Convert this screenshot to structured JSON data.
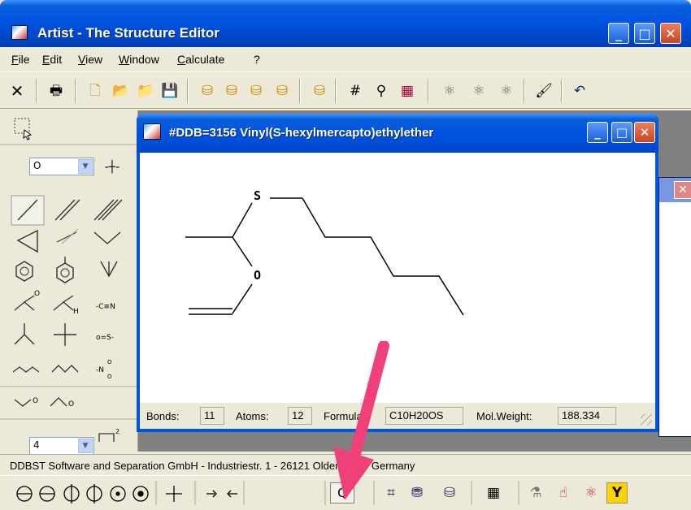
{
  "main_window": {
    "title": "Artist - The Structure Editor",
    "controls": {
      "minimize": "_",
      "maximize": "□",
      "close": "✕"
    }
  },
  "menu": [
    {
      "label": "File"
    },
    {
      "label": "Edit"
    },
    {
      "label": "View"
    },
    {
      "label": "Window"
    },
    {
      "label": "Calculate"
    },
    {
      "label": "?"
    }
  ],
  "toolbar": [
    {
      "icon": "delete-icon",
      "glyph": "✕"
    },
    {
      "icon": "print-icon",
      "glyph": "🖶"
    },
    {
      "icon": "new-icon",
      "glyph": "🗋"
    },
    {
      "icon": "open-icon",
      "glyph": "📂"
    },
    {
      "icon": "open-db-icon",
      "glyph": "📁"
    },
    {
      "icon": "save-icon",
      "glyph": "💾"
    },
    {
      "icon": "db-load-icon",
      "glyph": "⛁"
    },
    {
      "icon": "db-load2-icon",
      "glyph": "⛁"
    },
    {
      "icon": "db-store-icon",
      "glyph": "⛁"
    },
    {
      "icon": "db-delete-icon",
      "glyph": "⛁"
    },
    {
      "icon": "db-add-icon",
      "glyph": "⛁"
    },
    {
      "icon": "ddb-number-icon",
      "glyph": "#"
    },
    {
      "icon": "search-structure-icon",
      "glyph": "⚲"
    },
    {
      "icon": "grid-icon",
      "glyph": "▦"
    },
    {
      "icon": "group-icon",
      "glyph": "⚛"
    },
    {
      "icon": "group2-icon",
      "glyph": "⚛"
    },
    {
      "icon": "group3-icon",
      "glyph": "⚛"
    },
    {
      "icon": "brush-icon",
      "glyph": "🖌"
    },
    {
      "icon": "undo-icon",
      "glyph": "↶"
    }
  ],
  "palette": {
    "atom_value": "O",
    "ring_value": "4"
  },
  "child_window": {
    "title": "#DDB=3156  Vinyl(S-hexylmercapto)ethylether",
    "controls": {
      "minimize": "_",
      "maximize": "□",
      "close": "✕"
    },
    "atoms": {
      "sulfur": "S",
      "oxygen": "O"
    },
    "status": {
      "bonds_label": "Bonds:",
      "bonds_value": "11",
      "atoms_label": "Atoms:",
      "atoms_value": "12",
      "formula_label": "Formula:",
      "formula_value": "C10H20OS",
      "molweight_label": "Mol.Weight:",
      "molweight_value": "188.334"
    }
  },
  "footer": {
    "status_text": "DDBST Software and Separation GmbH - Industriestr. 1 - 26121 Oldenburg - Germany"
  },
  "colors": {
    "title_blue": "#0054e3",
    "window_face": "#ece9d8",
    "annotation_arrow": "#f0407a"
  }
}
